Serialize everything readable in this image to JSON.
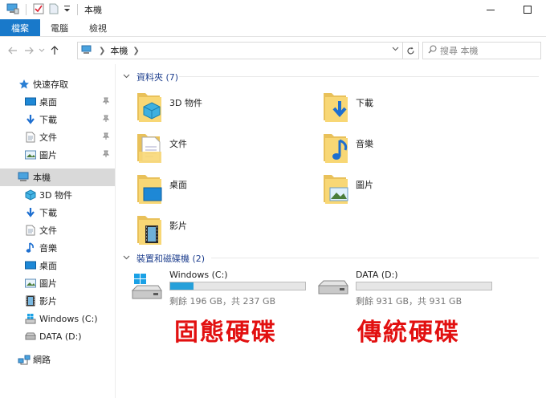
{
  "window": {
    "title": "本機"
  },
  "ribbon": {
    "tabs": [
      "檔案",
      "電腦",
      "檢視"
    ]
  },
  "address": {
    "crumb": "本機"
  },
  "search": {
    "placeholder": "搜尋 本機"
  },
  "sidebar": {
    "quick_access": "快速存取",
    "quick_items": [
      "桌面",
      "下載",
      "文件",
      "圖片"
    ],
    "this_pc": "本機",
    "pc_items": [
      "3D 物件",
      "下載",
      "文件",
      "音樂",
      "桌面",
      "圖片",
      "影片",
      "Windows (C:)",
      "DATA (D:)"
    ],
    "network": "網路"
  },
  "folders": {
    "header": "資料夾 (7)",
    "items": [
      "3D 物件",
      "下載",
      "文件",
      "音樂",
      "桌面",
      "圖片",
      "影片"
    ]
  },
  "devices": {
    "header": "裝置和磁碟機 (2)",
    "drives": [
      {
        "name": "Windows (C:)",
        "info": "剩餘 196 GB，共 237 GB",
        "used_fraction": 0.17
      },
      {
        "name": "DATA (D:)",
        "info": "剩餘 931 GB，共 931 GB",
        "used_fraction": 0.0
      }
    ]
  },
  "annotations": {
    "ssd": "固態硬碟",
    "hdd": "傳統硬碟"
  },
  "colors": {
    "accent": "#1979ca",
    "progress": "#26a0da",
    "annotation": "#e21010",
    "group_header": "#1e3f8e"
  }
}
